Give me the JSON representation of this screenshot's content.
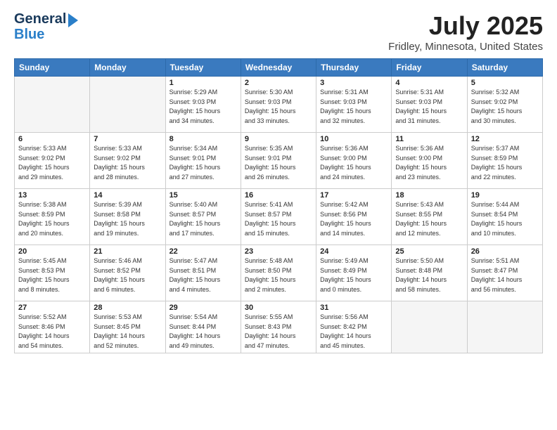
{
  "header": {
    "logo_general": "General",
    "logo_blue": "Blue",
    "month_title": "July 2025",
    "location": "Fridley, Minnesota, United States"
  },
  "weekdays": [
    "Sunday",
    "Monday",
    "Tuesday",
    "Wednesday",
    "Thursday",
    "Friday",
    "Saturday"
  ],
  "weeks": [
    [
      {
        "day": "",
        "sunrise": "",
        "sunset": "",
        "daylight": ""
      },
      {
        "day": "",
        "sunrise": "",
        "sunset": "",
        "daylight": ""
      },
      {
        "day": "1",
        "sunrise": "Sunrise: 5:29 AM",
        "sunset": "Sunset: 9:03 PM",
        "daylight": "Daylight: 15 hours and 34 minutes."
      },
      {
        "day": "2",
        "sunrise": "Sunrise: 5:30 AM",
        "sunset": "Sunset: 9:03 PM",
        "daylight": "Daylight: 15 hours and 33 minutes."
      },
      {
        "day": "3",
        "sunrise": "Sunrise: 5:31 AM",
        "sunset": "Sunset: 9:03 PM",
        "daylight": "Daylight: 15 hours and 32 minutes."
      },
      {
        "day": "4",
        "sunrise": "Sunrise: 5:31 AM",
        "sunset": "Sunset: 9:03 PM",
        "daylight": "Daylight: 15 hours and 31 minutes."
      },
      {
        "day": "5",
        "sunrise": "Sunrise: 5:32 AM",
        "sunset": "Sunset: 9:02 PM",
        "daylight": "Daylight: 15 hours and 30 minutes."
      }
    ],
    [
      {
        "day": "6",
        "sunrise": "Sunrise: 5:33 AM",
        "sunset": "Sunset: 9:02 PM",
        "daylight": "Daylight: 15 hours and 29 minutes."
      },
      {
        "day": "7",
        "sunrise": "Sunrise: 5:33 AM",
        "sunset": "Sunset: 9:02 PM",
        "daylight": "Daylight: 15 hours and 28 minutes."
      },
      {
        "day": "8",
        "sunrise": "Sunrise: 5:34 AM",
        "sunset": "Sunset: 9:01 PM",
        "daylight": "Daylight: 15 hours and 27 minutes."
      },
      {
        "day": "9",
        "sunrise": "Sunrise: 5:35 AM",
        "sunset": "Sunset: 9:01 PM",
        "daylight": "Daylight: 15 hours and 26 minutes."
      },
      {
        "day": "10",
        "sunrise": "Sunrise: 5:36 AM",
        "sunset": "Sunset: 9:00 PM",
        "daylight": "Daylight: 15 hours and 24 minutes."
      },
      {
        "day": "11",
        "sunrise": "Sunrise: 5:36 AM",
        "sunset": "Sunset: 9:00 PM",
        "daylight": "Daylight: 15 hours and 23 minutes."
      },
      {
        "day": "12",
        "sunrise": "Sunrise: 5:37 AM",
        "sunset": "Sunset: 8:59 PM",
        "daylight": "Daylight: 15 hours and 22 minutes."
      }
    ],
    [
      {
        "day": "13",
        "sunrise": "Sunrise: 5:38 AM",
        "sunset": "Sunset: 8:59 PM",
        "daylight": "Daylight: 15 hours and 20 minutes."
      },
      {
        "day": "14",
        "sunrise": "Sunrise: 5:39 AM",
        "sunset": "Sunset: 8:58 PM",
        "daylight": "Daylight: 15 hours and 19 minutes."
      },
      {
        "day": "15",
        "sunrise": "Sunrise: 5:40 AM",
        "sunset": "Sunset: 8:57 PM",
        "daylight": "Daylight: 15 hours and 17 minutes."
      },
      {
        "day": "16",
        "sunrise": "Sunrise: 5:41 AM",
        "sunset": "Sunset: 8:57 PM",
        "daylight": "Daylight: 15 hours and 15 minutes."
      },
      {
        "day": "17",
        "sunrise": "Sunrise: 5:42 AM",
        "sunset": "Sunset: 8:56 PM",
        "daylight": "Daylight: 15 hours and 14 minutes."
      },
      {
        "day": "18",
        "sunrise": "Sunrise: 5:43 AM",
        "sunset": "Sunset: 8:55 PM",
        "daylight": "Daylight: 15 hours and 12 minutes."
      },
      {
        "day": "19",
        "sunrise": "Sunrise: 5:44 AM",
        "sunset": "Sunset: 8:54 PM",
        "daylight": "Daylight: 15 hours and 10 minutes."
      }
    ],
    [
      {
        "day": "20",
        "sunrise": "Sunrise: 5:45 AM",
        "sunset": "Sunset: 8:53 PM",
        "daylight": "Daylight: 15 hours and 8 minutes."
      },
      {
        "day": "21",
        "sunrise": "Sunrise: 5:46 AM",
        "sunset": "Sunset: 8:52 PM",
        "daylight": "Daylight: 15 hours and 6 minutes."
      },
      {
        "day": "22",
        "sunrise": "Sunrise: 5:47 AM",
        "sunset": "Sunset: 8:51 PM",
        "daylight": "Daylight: 15 hours and 4 minutes."
      },
      {
        "day": "23",
        "sunrise": "Sunrise: 5:48 AM",
        "sunset": "Sunset: 8:50 PM",
        "daylight": "Daylight: 15 hours and 2 minutes."
      },
      {
        "day": "24",
        "sunrise": "Sunrise: 5:49 AM",
        "sunset": "Sunset: 8:49 PM",
        "daylight": "Daylight: 15 hours and 0 minutes."
      },
      {
        "day": "25",
        "sunrise": "Sunrise: 5:50 AM",
        "sunset": "Sunset: 8:48 PM",
        "daylight": "Daylight: 14 hours and 58 minutes."
      },
      {
        "day": "26",
        "sunrise": "Sunrise: 5:51 AM",
        "sunset": "Sunset: 8:47 PM",
        "daylight": "Daylight: 14 hours and 56 minutes."
      }
    ],
    [
      {
        "day": "27",
        "sunrise": "Sunrise: 5:52 AM",
        "sunset": "Sunset: 8:46 PM",
        "daylight": "Daylight: 14 hours and 54 minutes."
      },
      {
        "day": "28",
        "sunrise": "Sunrise: 5:53 AM",
        "sunset": "Sunset: 8:45 PM",
        "daylight": "Daylight: 14 hours and 52 minutes."
      },
      {
        "day": "29",
        "sunrise": "Sunrise: 5:54 AM",
        "sunset": "Sunset: 8:44 PM",
        "daylight": "Daylight: 14 hours and 49 minutes."
      },
      {
        "day": "30",
        "sunrise": "Sunrise: 5:55 AM",
        "sunset": "Sunset: 8:43 PM",
        "daylight": "Daylight: 14 hours and 47 minutes."
      },
      {
        "day": "31",
        "sunrise": "Sunrise: 5:56 AM",
        "sunset": "Sunset: 8:42 PM",
        "daylight": "Daylight: 14 hours and 45 minutes."
      },
      {
        "day": "",
        "sunrise": "",
        "sunset": "",
        "daylight": ""
      },
      {
        "day": "",
        "sunrise": "",
        "sunset": "",
        "daylight": ""
      }
    ]
  ]
}
